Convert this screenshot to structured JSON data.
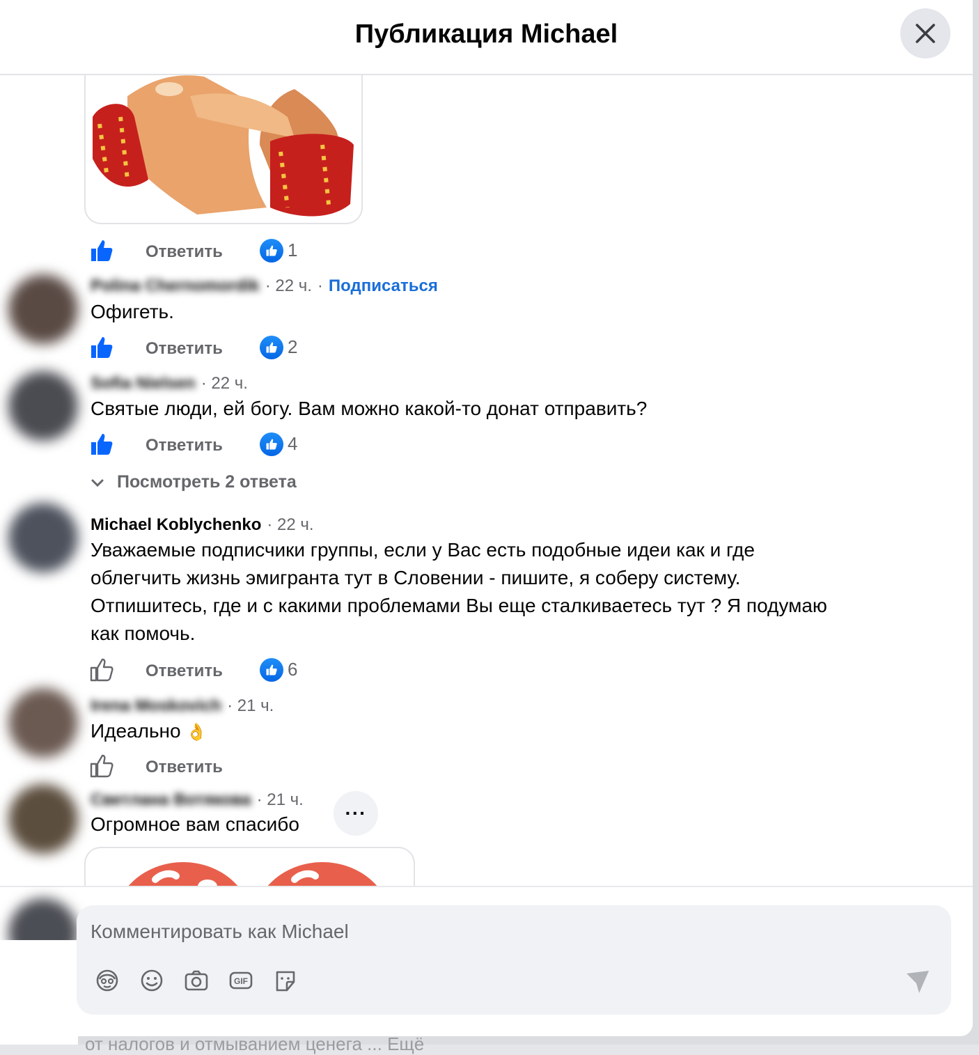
{
  "modal": {
    "title": "Публикация Michael"
  },
  "background": {
    "text": "от налогов и отмыванием ценега ... Ещё"
  },
  "comments": [
    {
      "actions": {
        "reply_label": "Ответить",
        "reactions": "1"
      }
    },
    {
      "author": "Polina Chernomordik",
      "time": "· 22 ч.",
      "separator": "·",
      "follow_label": "Подписаться",
      "text": "Офигеть.",
      "actions": {
        "reply_label": "Ответить",
        "reactions": "2"
      }
    },
    {
      "author": "Sofia Nielsen",
      "time": "· 22 ч.",
      "text": "Святые люди, ей богу. Вам можно какой-то донат отправить?",
      "actions": {
        "reply_label": "Ответить",
        "reactions": "4"
      },
      "view_replies_label": "Посмотреть 2 ответа"
    },
    {
      "author": "Michael Koblychenko",
      "time": "· 22 ч.",
      "text_lines": [
        "Уважаемые подписчики группы, если у Вас есть подобные идеи как и где",
        "облегчить жизнь эмигранта тут в Словении - пишите, я соберу систему.",
        "Отпишитесь, где и с какими проблемами Вы еще сталкиваетесь тут ? Я подумаю",
        "как помочь."
      ],
      "actions": {
        "reply_label": "Ответить",
        "reactions": "6"
      }
    },
    {
      "author": "Irena Moskovich",
      "time": "· 21 ч.",
      "text": "Идеально",
      "emoji": "👌",
      "actions": {
        "reply_label": "Ответить"
      }
    },
    {
      "author": "Светлана Вотякова",
      "time": "· 21 ч.",
      "text": "Огромное вам спасибо",
      "more_label": "···"
    }
  ],
  "composer": {
    "placeholder": "Комментировать как Michael"
  },
  "icons": {
    "close": "close-icon",
    "like": "thumbs-up-icon",
    "tools": [
      "avatar-sticker-icon",
      "emoji-icon",
      "camera-icon",
      "gif-icon",
      "sticker-icon"
    ],
    "send": "send-icon"
  },
  "colors": {
    "accent": "#1a6ed8",
    "like_blue": "#0866ff",
    "secondary_text": "#65676b"
  }
}
